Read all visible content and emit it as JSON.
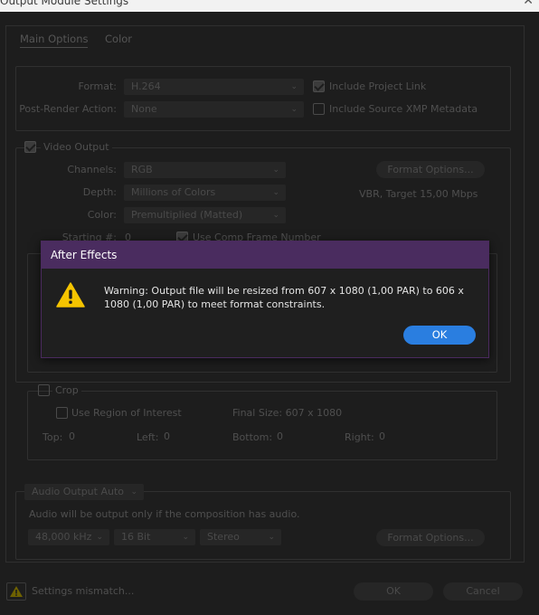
{
  "window": {
    "title": "Output Module Settings",
    "close_glyph": "✕"
  },
  "tabs": [
    {
      "label": "Main Options"
    },
    {
      "label": "Color"
    }
  ],
  "format_section": {
    "format_label": "Format:",
    "format_value": "H.264",
    "post_render_label": "Post-Render Action:",
    "post_render_value": "None",
    "include_project_link": "Include Project Link",
    "include_xmp": "Include Source XMP Metadata"
  },
  "video_output": {
    "title": "Video Output",
    "channels_label": "Channels:",
    "channels_value": "RGB",
    "depth_label": "Depth:",
    "depth_value": "Millions of Colors",
    "color_label": "Color:",
    "color_value": "Premultiplied (Matted)",
    "format_options_button": "Format Options...",
    "bitrate_text": "VBR, Target 15,00 Mbps",
    "starting_label": "Starting #:",
    "starting_value": "0",
    "use_comp_frame": "Use Comp Frame Number"
  },
  "crop": {
    "title": "Crop",
    "use_roi": "Use Region of Interest",
    "final_size": "Final Size: 607 x 1080",
    "top_label": "Top:",
    "top_value": "0",
    "left_label": "Left:",
    "left_value": "0",
    "bottom_label": "Bottom:",
    "bottom_value": "0",
    "right_label": "Right:",
    "right_value": "0"
  },
  "audio": {
    "dropdown": "Audio Output Auto",
    "note": "Audio will be output only if the composition has audio.",
    "rate": "48,000 kHz",
    "bits": "16 Bit",
    "channels": "Stereo",
    "format_options_button": "Format Options..."
  },
  "footer": {
    "warning_text": "Settings mismatch...",
    "ok_button": "OK",
    "cancel_button": "Cancel"
  },
  "dialog": {
    "title": "After Effects",
    "message": "Warning: Output file will be resized from 607 x 1080 (1,00 PAR) to 606 x 1080 (1,00 PAR) to meet format constraints.",
    "ok_button": "OK"
  },
  "icons": {
    "chevron": "⌄"
  },
  "colors": {
    "accent": "#2a7ee0",
    "dialog_title_bg": "#4a2c5f",
    "warning": "#f5c400"
  }
}
